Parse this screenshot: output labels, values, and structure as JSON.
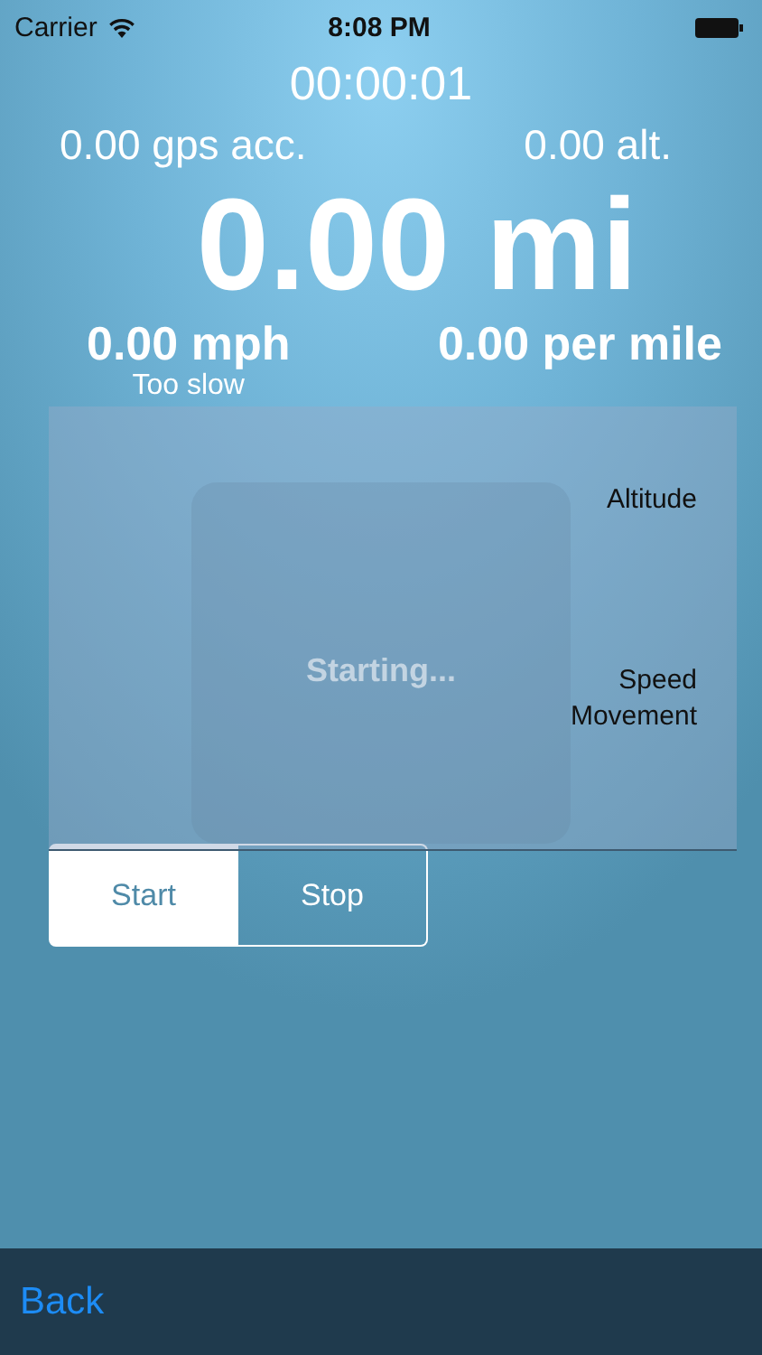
{
  "status_bar": {
    "carrier": "Carrier",
    "time": "8:08 PM"
  },
  "timer": "00:00:01",
  "gps_accuracy": "0.00 gps acc.",
  "altitude": "0.00 alt.",
  "distance": "0.00 mi",
  "speed": "0.00 mph",
  "speed_note": "Too slow",
  "pace": "0.00 per mile",
  "chart_panel": {
    "legend": [
      "Altitude",
      "Speed\nMovement"
    ],
    "overlay": "Starting..."
  },
  "segments": [
    {
      "label": "Start",
      "selected": true
    },
    {
      "label": "Stop",
      "selected": false
    }
  ],
  "bottom_bar": {
    "back": "Back"
  }
}
